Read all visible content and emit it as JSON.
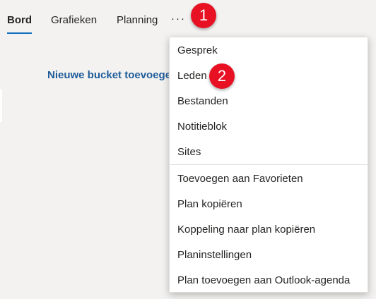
{
  "tabs": {
    "items": [
      {
        "label": "Bord"
      },
      {
        "label": "Grafieken"
      },
      {
        "label": "Planning"
      }
    ],
    "more_label": "···"
  },
  "markers": {
    "one": "1",
    "two": "2"
  },
  "bucket": {
    "add_label": "Nieuwe bucket toevoegen"
  },
  "menu": {
    "items": [
      {
        "label": "Gesprek"
      },
      {
        "label": "Leden"
      },
      {
        "label": "Bestanden"
      },
      {
        "label": "Notitieblok"
      },
      {
        "label": "Sites"
      },
      {
        "label": "Toevoegen aan Favorieten"
      },
      {
        "label": "Plan kopiëren"
      },
      {
        "label": "Koppeling naar plan kopiëren"
      },
      {
        "label": "Planinstellingen"
      },
      {
        "label": "Plan toevoegen aan Outlook-agenda"
      }
    ]
  },
  "colors": {
    "accent": "#106ebe",
    "link": "#1f5c99",
    "marker": "#e81123",
    "background": "#f3f2f1"
  }
}
